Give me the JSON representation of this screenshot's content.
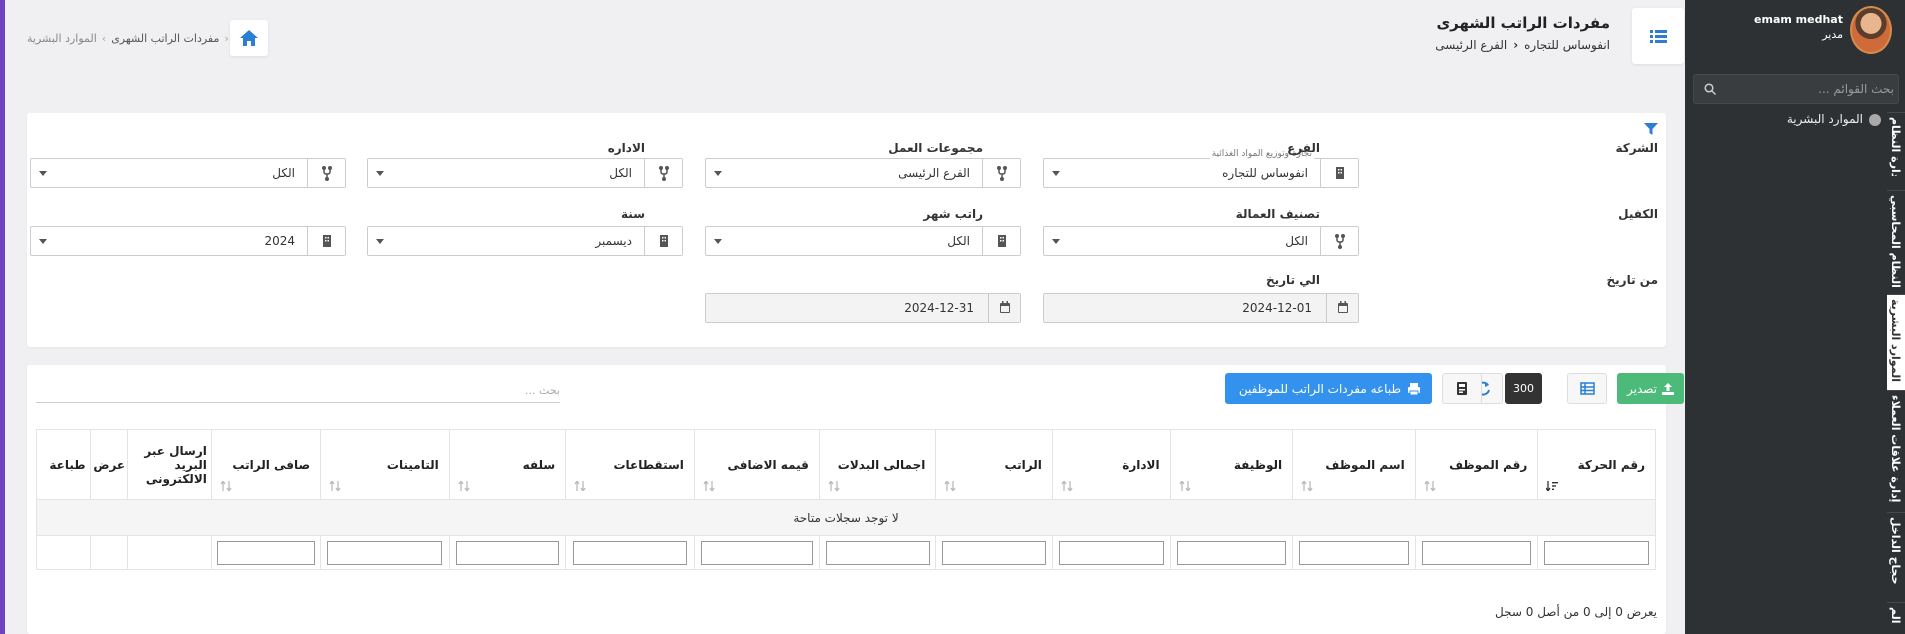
{
  "user": {
    "name": "emam medhat",
    "role": "مدير"
  },
  "sidebar": {
    "search_placeholder": "بحث القوائم ...",
    "hr_item": "الموارد البشرية",
    "vtabs": [
      "إدارة النظام",
      "النظام المحاسبي",
      "الموارد البشرية",
      "إدارة علاقات العملاء",
      "حجاج الداخل",
      "الم"
    ]
  },
  "header": {
    "title": "مفردات الراتب الشهرى",
    "company": "انفوساس للتجاره",
    "branch": "الفرع الرئيسى",
    "breadcrumb": [
      "الموارد البشرية",
      "مفردات الراتب الشهرى"
    ]
  },
  "filters": {
    "company": {
      "label": "الشركة",
      "value": "انفوساس للتجاره",
      "hint": "تجارة وتوزيع المواد الغذائية"
    },
    "branch": {
      "label": "الفرع",
      "value": "الفرع الرئيسى"
    },
    "workgroups": {
      "label": "مجموعات العمل",
      "value": "الكل"
    },
    "department": {
      "label": "الاداره",
      "value": "الكل"
    },
    "sponsor": {
      "label": "الكفيل",
      "value": "الكل"
    },
    "labor_class": {
      "label": "تصنيف العمالة",
      "value": "الكل"
    },
    "salary_month": {
      "label": "راتب شهر",
      "value": "ديسمبر"
    },
    "year": {
      "label": "سنة",
      "value": "2024"
    },
    "from_date": {
      "label": "من تاريخ",
      "value": "2024-12-01"
    },
    "to_date": {
      "label": "الي تاريخ",
      "value": "2024-12-31"
    }
  },
  "toolbar": {
    "export_label": "تصدير",
    "page_size": "300",
    "print_label": "طباعه مفردات الراتب للموظفين",
    "search_placeholder": "بحث ..."
  },
  "table": {
    "columns": [
      "رقم الحركة",
      "رقم الموظف",
      "اسم الموظف",
      "الوظيفة",
      "الادارة",
      "الراتب",
      "اجمالى البدلات",
      "قيمه الاضافى",
      "استقطاعات",
      "سلفه",
      "التامينات",
      "صافى الراتب",
      "ارسال عبر البريد الالكترونى",
      "عرض",
      "طباعة"
    ],
    "empty_message": "لا توجد سجلات متاحة",
    "footer": "يعرض 0 إلى 0 من أصل 0 سجل"
  },
  "colors": {
    "export": "#4cbb7a",
    "print": "#3392ee",
    "sidebar": "#2e3133",
    "accent": "#6f42c1"
  }
}
